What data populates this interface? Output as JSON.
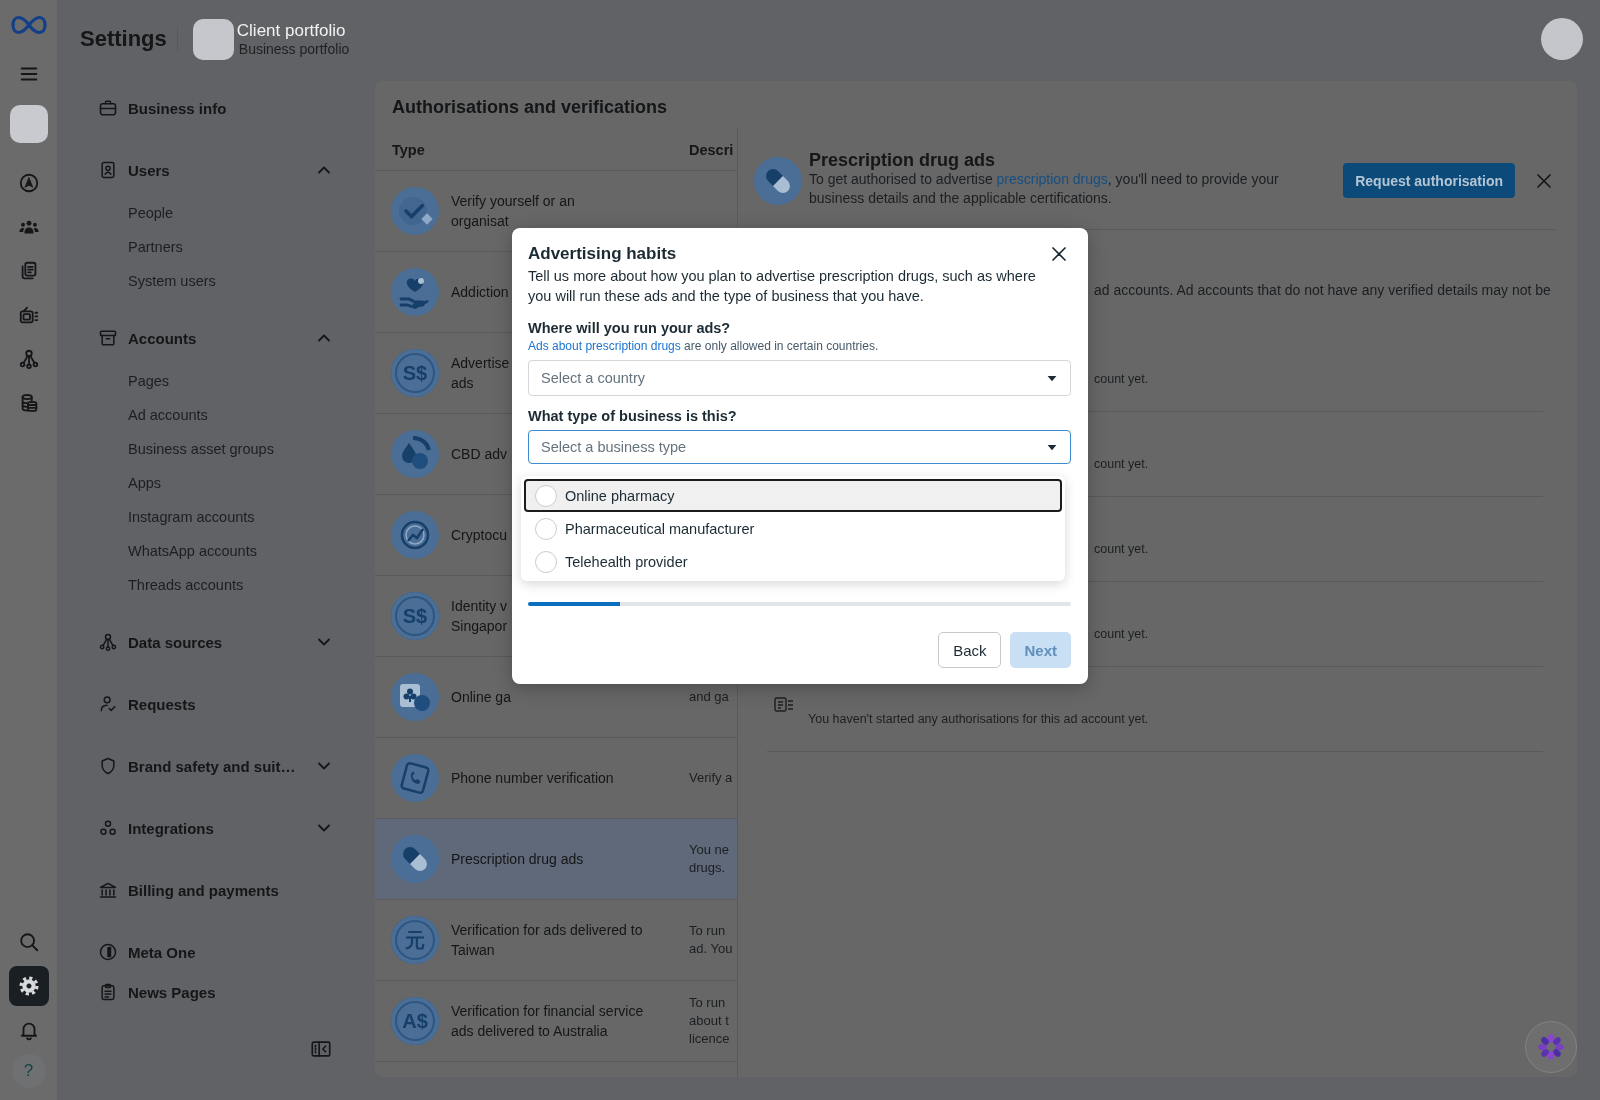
{
  "rail": {
    "items": [
      {
        "selected": false
      },
      {
        "selected": false
      },
      {
        "selected": false
      },
      {
        "selected": false
      },
      {
        "selected": false
      },
      {
        "selected": false
      }
    ],
    "tools": [
      {
        "selected": false
      },
      {
        "selected": true
      },
      {
        "selected": false
      }
    ],
    "help": "?"
  },
  "header": {
    "title": "Settings",
    "portfolio_name": "Client portfolio",
    "portfolio_type": "Business portfolio"
  },
  "sidebar": {
    "items": [
      {
        "kind": "link",
        "label": "Business info"
      },
      {
        "kind": "group",
        "label": "Users",
        "expanded": true,
        "children": [
          {
            "label": "People"
          },
          {
            "label": "Partners"
          },
          {
            "label": "System users"
          }
        ]
      },
      {
        "kind": "group",
        "label": "Accounts",
        "expanded": true,
        "children": [
          {
            "label": "Pages"
          },
          {
            "label": "Ad accounts"
          },
          {
            "label": "Business asset groups"
          },
          {
            "label": "Apps"
          },
          {
            "label": "Instagram accounts"
          },
          {
            "label": "WhatsApp accounts"
          },
          {
            "label": "Threads accounts"
          }
        ]
      },
      {
        "kind": "group",
        "label": "Data sources",
        "expanded": false
      },
      {
        "kind": "link",
        "label": "Requests"
      },
      {
        "kind": "group",
        "label": "Brand safety and suit…",
        "expanded": false
      },
      {
        "kind": "group",
        "label": "Integrations",
        "expanded": false
      },
      {
        "kind": "link",
        "label": "Billing and payments"
      },
      {
        "kind": "link",
        "label": "Meta One"
      },
      {
        "kind": "link",
        "label": "News Pages"
      }
    ]
  },
  "main": {
    "title": "Authorisations and verifications",
    "columns": [
      "Type",
      "Descri"
    ],
    "rows": [
      {
        "type_lines": [
          "Verify yourself or an",
          "organisat"
        ],
        "selected": false
      },
      {
        "type_lines": [
          "Addiction"
        ],
        "selected": false
      },
      {
        "type_lines": [
          "Advertise",
          "ads"
        ],
        "symbol": "S$",
        "selected": false
      },
      {
        "type_lines": [
          "CBD adv"
        ],
        "selected": false
      },
      {
        "type_lines": [
          "Cryptocu"
        ],
        "selected": false
      },
      {
        "type_lines": [
          "Identity v",
          "Singapor"
        ],
        "symbol": "S$",
        "selected": false
      },
      {
        "type_lines": [
          "Online ga"
        ],
        "description_lines": [
          "and ga"
        ],
        "selected": false
      },
      {
        "type_lines": [
          "Phone number verification"
        ],
        "description_lines": [
          "Verify a"
        ],
        "selected": false
      },
      {
        "type_lines": [
          "Prescription drug ads"
        ],
        "description_lines": [
          "You ne",
          "drugs."
        ],
        "selected": true
      },
      {
        "type_lines": [
          "Verification for ads delivered to",
          "Taiwan"
        ],
        "description_lines": [
          "To run",
          "ad. You"
        ],
        "symbol": "元",
        "selected": false
      },
      {
        "type_lines": [
          "Verification for financial service",
          "ads delivered to Australia"
        ],
        "description_lines": [
          "To run",
          "about t",
          "licence"
        ],
        "symbol": "A$",
        "selected": false
      }
    ]
  },
  "detail": {
    "title": "Prescription drug ads",
    "description_start": "To get authorised to advertise",
    "description_link": "prescription drugs",
    "description_end": ", you'll need to provide your business details and the applicable certifications.",
    "request_button": "Request authorisation",
    "notice": "ad accounts. Ad accounts that do not have any verified details may not be",
    "account_rows": [
      {
        "kind": "fragment",
        "text": "count yet."
      },
      {
        "kind": "fragment",
        "text": "count yet."
      },
      {
        "kind": "fragment",
        "text": "count yet."
      },
      {
        "kind": "fragment",
        "text": "count yet."
      },
      {
        "kind": "full",
        "text": "You haven't started any authorisations for this ad account yet."
      }
    ]
  },
  "modal": {
    "title": "Advertising habits",
    "description": "Tell us more about how you plan to advertise prescription drugs, such as where you will run these ads and the type of business that you have.",
    "fields": [
      {
        "label": "Where will you run your ads?",
        "note_link": "Ads about prescription drugs",
        "note": "are only allowed in certain countries.",
        "placeholder": "Select a country",
        "focused": false
      },
      {
        "label": "What type of business is this?",
        "placeholder": "Select a business type",
        "focused": true,
        "open": true,
        "options": [
          {
            "label": "Online pharmacy",
            "selected": false,
            "highlighted": true
          },
          {
            "label": "Pharmaceutical manufacturer",
            "selected": false,
            "highlighted": false
          },
          {
            "label": "Telehealth provider",
            "selected": false,
            "highlighted": false
          }
        ]
      }
    ],
    "progress": {
      "level": 0.17
    },
    "buttons": [
      {
        "label": "Back",
        "kind": "secondary",
        "disabled": false
      },
      {
        "label": "Next",
        "kind": "primary",
        "disabled": true
      }
    ]
  }
}
